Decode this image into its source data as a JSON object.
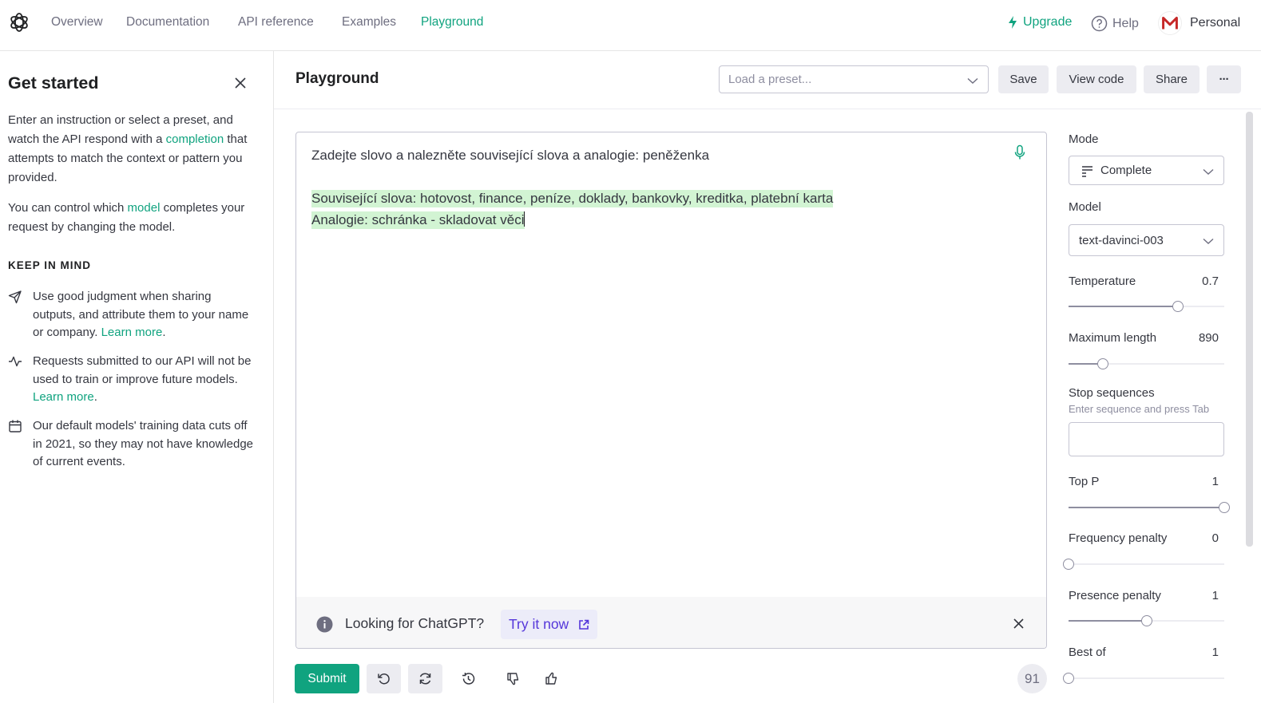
{
  "nav": {
    "items": [
      "Overview",
      "Documentation",
      "API reference",
      "Examples",
      "Playground"
    ],
    "upgrade": "Upgrade",
    "help": "Help",
    "account": "Personal"
  },
  "sidebar": {
    "title": "Get started",
    "intro_a": "Enter an instruction or select a preset, and watch the API respond with a ",
    "intro_link": "completion",
    "intro_b": " that attempts to match the context or pattern you provided.",
    "model_a": "You can control which ",
    "model_link": "model",
    "model_b": " completes your request by changing the model.",
    "keep_heading": "KEEP IN MIND",
    "tips": [
      {
        "text": "Use good judgment when sharing outputs, and attribute them to your name or company. ",
        "link": "Learn more",
        "tail": "."
      },
      {
        "text": "Requests submitted to our API will not be used to train or improve future models. ",
        "link": "Learn more",
        "tail": "."
      },
      {
        "text": "Our default models' training data cuts off in 2021, so they may not have knowledge of current events.",
        "link": "",
        "tail": ""
      }
    ]
  },
  "header": {
    "title": "Playground",
    "preset_placeholder": "Load a preset...",
    "save": "Save",
    "view_code": "View code",
    "share": "Share",
    "more": "···"
  },
  "editor": {
    "prompt": "Zadejte slovo a nalezněte související slova a analogie: peněženka",
    "completion_line1": "Související slova: hotovost, finance, peníze, doklady, bankovky, kreditka, platební karta",
    "completion_line2": "Analogie: schránka - skladovat věci"
  },
  "banner": {
    "text": "Looking for ChatGPT?",
    "cta": "Try it now"
  },
  "bottom": {
    "submit": "Submit",
    "token_count": "91"
  },
  "settings": {
    "mode_label": "Mode",
    "mode_value": "Complete",
    "model_label": "Model",
    "model_value": "text-davinci-003",
    "stop_label": "Stop sequences",
    "stop_hint": "Enter sequence and press Tab",
    "sliders": [
      {
        "label": "Temperature",
        "value": "0.7",
        "fraction": 0.7
      },
      {
        "label": "Maximum length",
        "value": "890",
        "fraction": 0.22
      },
      {
        "label": "Top P",
        "value": "1",
        "fraction": 1.0
      },
      {
        "label": "Frequency penalty",
        "value": "0",
        "fraction": 0.0
      },
      {
        "label": "Presence penalty",
        "value": "1",
        "fraction": 0.5
      },
      {
        "label": "Best of",
        "value": "1",
        "fraction": 0.0
      }
    ]
  },
  "colors": {
    "accent": "#10a37f",
    "completion_highlight": "#d2f4d3",
    "cta": "#5436da"
  }
}
